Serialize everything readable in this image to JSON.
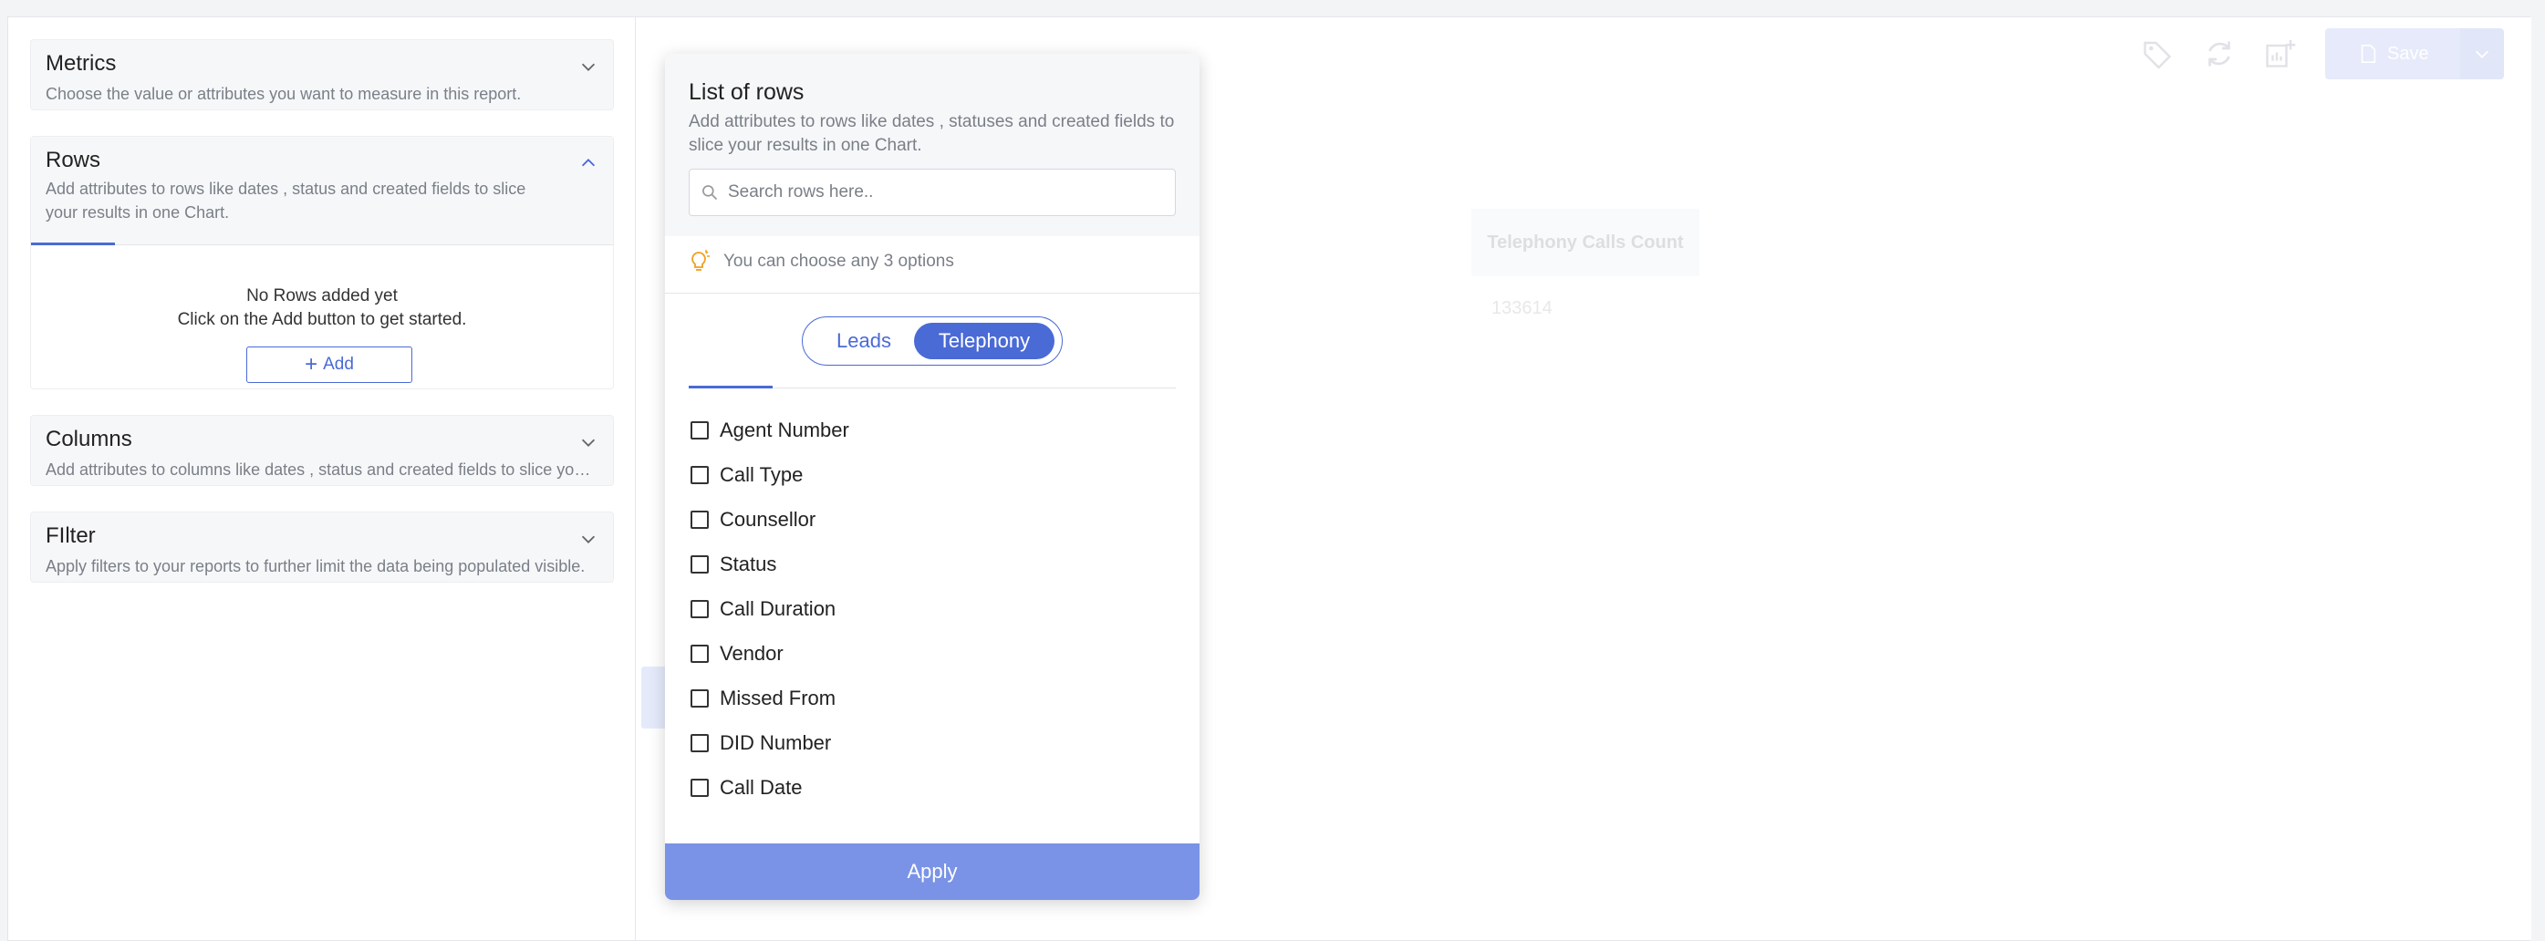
{
  "sidebar": {
    "metrics": {
      "title": "Metrics",
      "desc": "Choose the value or attributes you want to measure in this report."
    },
    "rows": {
      "title": "Rows",
      "desc_line1": "Add attributes to rows like dates , status and created fields to slice",
      "desc_line2": "your results in one Chart.",
      "empty_line1": "No Rows added yet",
      "empty_line2": "Click on the Add button to get started.",
      "add_label": "Add"
    },
    "columns": {
      "title": "Columns",
      "desc": "Add attributes to columns like dates , status and created fields to slice your results in one Chart."
    },
    "filter": {
      "title": "FIlter",
      "desc": "Apply filters to your reports to further limit the data being populated visible."
    }
  },
  "toolbar": {
    "save_label": "Save"
  },
  "report": {
    "metric_label": "Telephony Calls Count",
    "metric_value": "133614"
  },
  "popover": {
    "title": "List of rows",
    "desc": "Add attributes to rows like dates , statuses and created fields to slice your results in one Chart.",
    "search_placeholder": "Search rows here..",
    "hint": "You can choose any 3 options",
    "toggle": {
      "leads": "Leads",
      "telephony": "Telephony",
      "selected": "Telephony"
    },
    "options": [
      "Agent Number",
      "Call Type",
      "Counsellor",
      "Status",
      "Call Duration",
      "Vendor",
      "Missed From",
      "DID Number",
      "Call Date"
    ],
    "apply_label": "Apply"
  },
  "colors": {
    "accent": "#4a6ad6",
    "apply": "#7a93e6",
    "save": "#b8c4ef",
    "hint_icon": "#f0a020"
  }
}
